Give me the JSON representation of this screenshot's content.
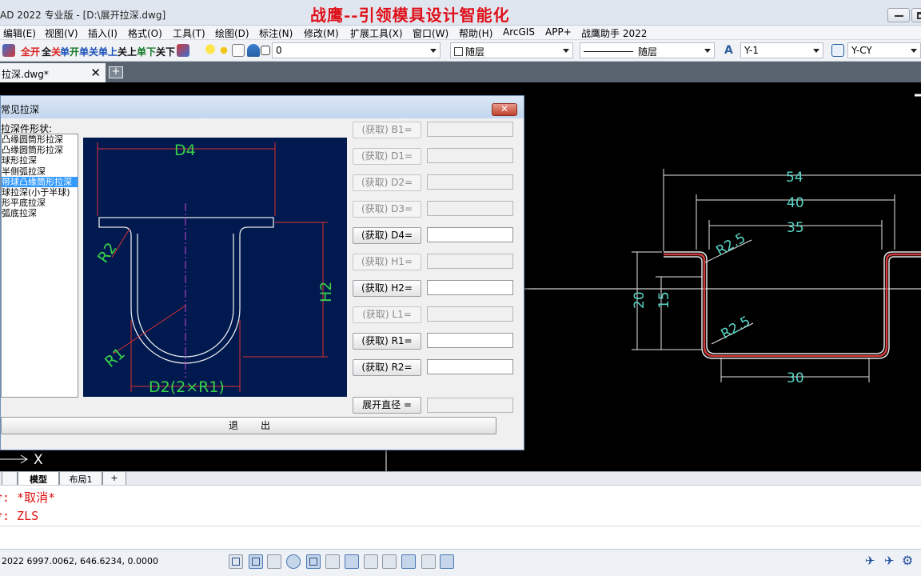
{
  "window": {
    "app_title": "AD 2022 专业版 - [D:\\展开拉深.dwg]",
    "banner": "战鹰--引领模具设计智能化"
  },
  "menu": [
    "编辑(E)",
    "视图(V)",
    "插入(I)",
    "格式(O)",
    "工具(T)",
    "绘图(D)",
    "标注(N)",
    "修改(M)",
    "扩展工具(X)",
    "窗口(W)",
    "帮助(H)",
    "ArcGIS",
    "APP+",
    "战鹰助手 2022"
  ],
  "toolbar": {
    "tools": [
      {
        "a": "全",
        "b": "开",
        "ca": "r",
        "cb": "r"
      },
      {
        "a": "全",
        "b": "关",
        "ca": "k",
        "cb": "r"
      },
      {
        "a": "单",
        "b": "开",
        "ca": "b",
        "cb": "g"
      },
      {
        "a": "单",
        "b": "关",
        "ca": "b",
        "cb": "b"
      },
      {
        "a": "单",
        "b": "上",
        "ca": "b",
        "cb": "b"
      },
      {
        "a": "关",
        "b": "上",
        "ca": "k",
        "cb": "k"
      },
      {
        "a": "单",
        "b": "下",
        "ca": "g",
        "cb": "g"
      },
      {
        "a": "关",
        "b": "下",
        "ca": "k",
        "cb": "k"
      }
    ],
    "layer_value": "0",
    "color_value": "随层",
    "linetype_value": "随层",
    "textstyle_value": "Y-1",
    "dimstyle_value": "Y-CY"
  },
  "tabs": {
    "document_tab": "拉深.dwg*",
    "close_glyph": "✕",
    "new_glyph": "+"
  },
  "dialog": {
    "title": "常见拉深",
    "close_glyph": "✕",
    "shape_label": "拉深件形状:",
    "shapes": [
      "凸缘圆筒形拉深",
      "凸缘圆筒形拉深",
      "球形拉深",
      "半侧弧拉深",
      "带球凸缘筒形拉深",
      "球拉深(小于半球)",
      "形平底拉深",
      "弧底拉深"
    ],
    "selected_index": 4,
    "preview_labels": {
      "d4": "D4",
      "r2": "R2",
      "h2": "H2",
      "r1": "R1",
      "d2": "D2(2×R1)"
    },
    "params": [
      {
        "label": "(获取) B1=",
        "enabled": false,
        "value": ""
      },
      {
        "label": "(获取) D1=",
        "enabled": false,
        "value": ""
      },
      {
        "label": "(获取) D2=",
        "enabled": false,
        "value": ""
      },
      {
        "label": "(获取) D3=",
        "enabled": false,
        "value": ""
      },
      {
        "label": "(获取) D4=",
        "enabled": true,
        "value": ""
      },
      {
        "label": "(获取) H1=",
        "enabled": false,
        "value": ""
      },
      {
        "label": "(获取) H2=",
        "enabled": true,
        "value": ""
      },
      {
        "label": "(获取) L1=",
        "enabled": false,
        "value": ""
      },
      {
        "label": "(获取) R1=",
        "enabled": true,
        "value": ""
      },
      {
        "label": "(获取) R2=",
        "enabled": true,
        "value": ""
      }
    ],
    "unfold_label": "展开直径 =",
    "unfold_value": "",
    "exit_label": "退出"
  },
  "drawing": {
    "dims": {
      "d54": "54",
      "d40": "40",
      "d35": "35",
      "d20": "20",
      "d15": "15",
      "d30": "30",
      "r_top": "R2.5",
      "r_bottom": "R2.5"
    },
    "ucs_x": "X"
  },
  "layouts": {
    "model": "模型",
    "layout1": "布局1",
    "add": "+"
  },
  "command": {
    "line1": "令: *取消*",
    "line2": "令: ZLS"
  },
  "status": {
    "coords": "2022  6997.0062, 646.6234, 0.0000"
  },
  "colors": {
    "accent_red": "#e0101a",
    "preview_bg": "#001a50",
    "preview_green": "#3ad04a",
    "dim_cyan": "#59d6c6",
    "selection": "#3399ff"
  }
}
